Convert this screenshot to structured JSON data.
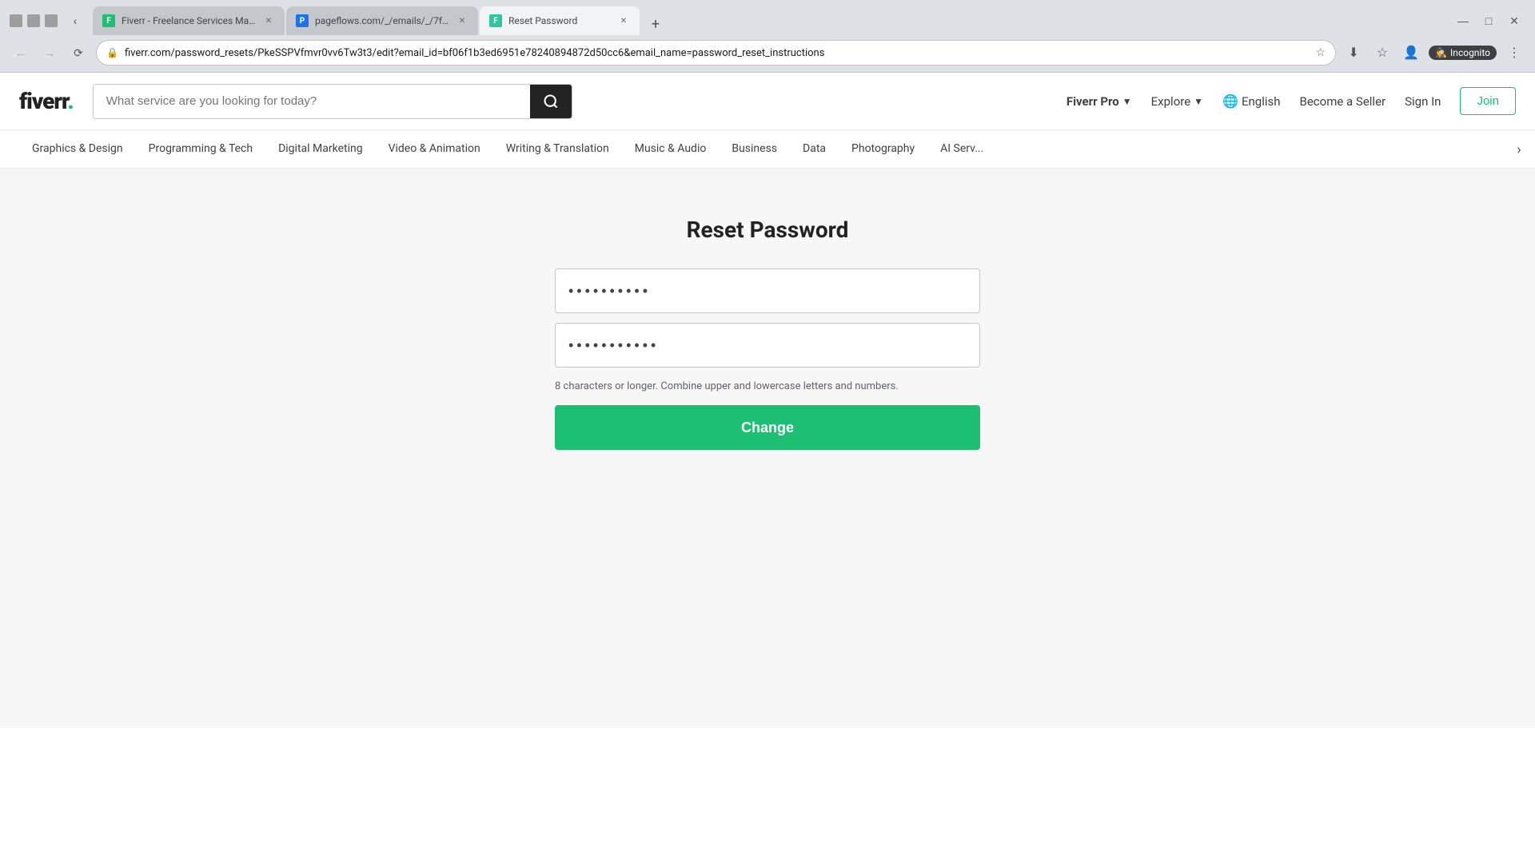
{
  "browser": {
    "tabs": [
      {
        "id": "tab1",
        "title": "Fiverr - Freelance Services Mar...",
        "favicon_color": "#1dbf73",
        "favicon_letter": "F",
        "active": false,
        "url": "fiverr.com"
      },
      {
        "id": "tab2",
        "title": "pageflows.com/_/emails/_/7fb5...",
        "favicon_color": "#1a73e8",
        "favicon_letter": "P",
        "active": false,
        "url": "pageflows.com"
      },
      {
        "id": "tab3",
        "title": "Reset Password",
        "favicon_color": "#2dc5a2",
        "favicon_letter": "F",
        "active": true,
        "url": "fiverr.com/password_resets/PkeSSPVfmvr0vv6Tw3t3/edit?email_id=bf06f1b3ed6951e78240894872d50cc6&email_name=password_reset_instructions"
      }
    ],
    "address_url": "fiverr.com/password_resets/PkeSSPVfmvr0vv6Tw3t3/edit?email_id=bf06f1b3ed6951e78240894872d50cc6&email_name=password_reset_instructions",
    "incognito_label": "Incognito"
  },
  "header": {
    "logo_text": "fiverr",
    "logo_dot": ".",
    "search_placeholder": "What service are you looking for today?",
    "nav": {
      "fiverr_pro_label": "Fiverr Pro",
      "explore_label": "Explore",
      "language_label": "English",
      "become_seller_label": "Become a Seller",
      "sign_in_label": "Sign In",
      "join_label": "Join"
    }
  },
  "categories": [
    "Graphics & Design",
    "Programming & Tech",
    "Digital Marketing",
    "Video & Animation",
    "Writing & Translation",
    "Music & Audio",
    "Business",
    "Data",
    "Photography",
    "AI Serv..."
  ],
  "main": {
    "title": "Reset Password",
    "password_placeholder": "••••••••••",
    "confirm_placeholder": "••••••••••",
    "password_value": "••••••••••",
    "confirm_value": "•••••••••••",
    "hint": "8 characters or longer. Combine upper and lowercase letters and numbers.",
    "change_button_label": "Change"
  }
}
